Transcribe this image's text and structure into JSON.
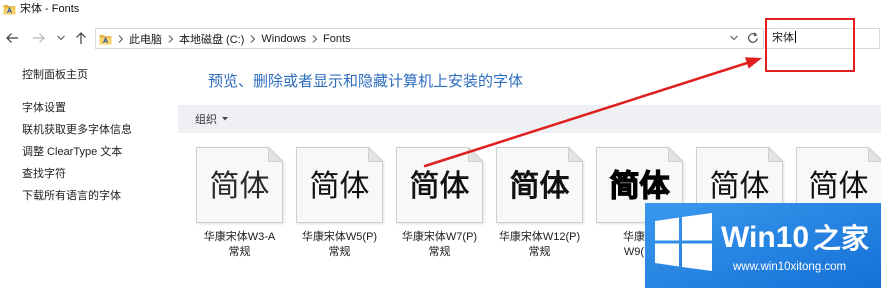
{
  "window": {
    "title": "宋体 - Fonts",
    "icon": "fonts-folder-icon"
  },
  "navigation": {
    "back_icon": "arrow-left-icon",
    "forward_icon": "arrow-right-icon",
    "recent_locations_icon": "chevron-down-icon",
    "up_icon": "arrow-up-icon"
  },
  "address_bar": {
    "location_icon": "fonts-folder-icon",
    "crumbs": [
      "此电脑",
      "本地磁盘 (C:)",
      "Windows",
      "Fonts"
    ],
    "separator_icon": "chevron-right-icon",
    "history_icon": "chevron-down-icon",
    "refresh_icon": "refresh-icon"
  },
  "search": {
    "value": "宋体"
  },
  "sidebar": {
    "items": [
      "控制面板主页",
      "字体设置",
      "联机获取更多字体信息",
      "调整 ClearType 文本",
      "查找字符",
      "下载所有语言的字体"
    ]
  },
  "main": {
    "heading": "预览、删除或者显示和隐藏计算机上安装的字体",
    "toolbar": {
      "organize_label": "组织",
      "organize_icon": "caret-down-icon"
    }
  },
  "fonts": [
    {
      "preview": "简体",
      "label": [
        "华康宋体W3-A",
        "常规"
      ]
    },
    {
      "preview": "简体",
      "label": [
        "华康宋体W5(P)",
        "常规"
      ]
    },
    {
      "preview": "简体",
      "label": [
        "华康宋体W7(P)",
        "常规"
      ]
    },
    {
      "preview": "简体",
      "label": [
        "华康宋体W12(P)",
        "常规"
      ]
    },
    {
      "preview": "简体",
      "label": [
        "华康雅",
        "W9(P)"
      ]
    },
    {
      "preview": "简体"
    },
    {
      "preview": "简体"
    }
  ],
  "watermark": {
    "logo": "windows-logo-icon",
    "brand": "Win10",
    "brand_suffix": "之家",
    "url": "www.win10xitong.com"
  },
  "colors": {
    "heading": "#2d6dbc",
    "toolbar_bg": "#eef0f4",
    "annotation": "#e01f1f",
    "watermark_bg": "#1470d6",
    "watermark_bg_light": "#3a99ee"
  }
}
